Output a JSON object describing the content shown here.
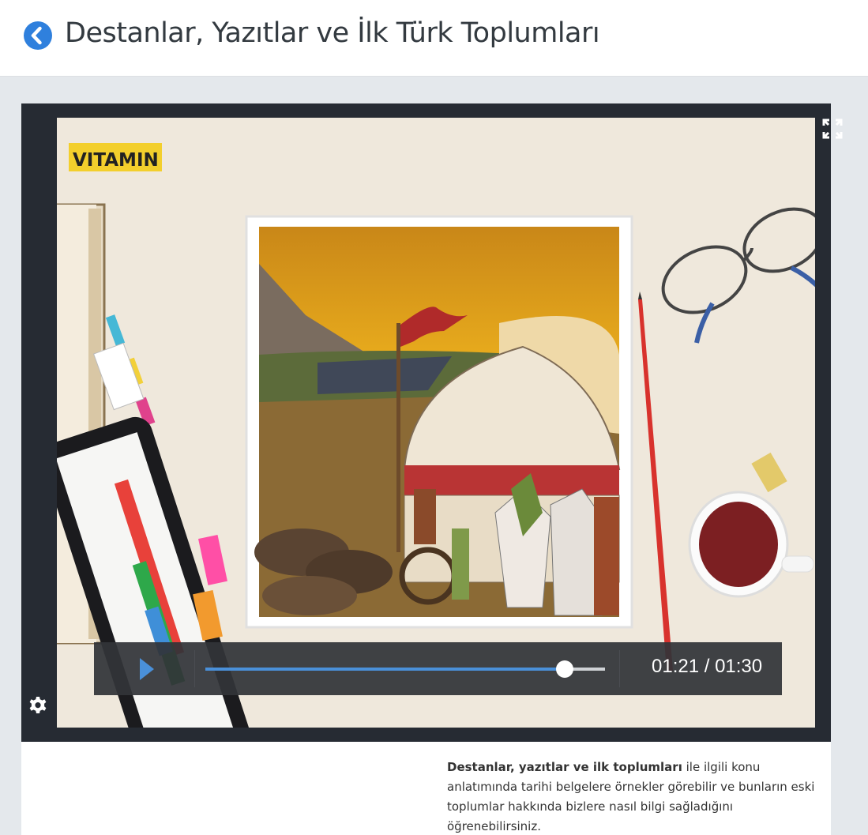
{
  "header": {
    "back_icon": "chevron-left-icon",
    "title": "Destanlar, Yazıtlar ve İlk Türk Toplumları"
  },
  "video": {
    "logo_text": "VITAMIN",
    "current_time": "01:21",
    "duration": "01:30",
    "time_display": "01:21 / 01:30",
    "progress_fraction": 0.9,
    "play_icon": "play-icon",
    "fullscreen_icon": "fullscreen-icon",
    "settings_icon": "gear-icon"
  },
  "description": {
    "bold": "Destanlar, yazıtlar ve ilk toplumları",
    "rest": " ile ilgili konu anlatımında tarihi belgelere örnekler görebilir ve bunların eski toplumlar hakkında bizlere nasıl bilgi sağladığını öğrenebilirsiniz."
  },
  "colors": {
    "accent": "#2f80dd",
    "player_bg": "#262b33",
    "seek_fill": "#4a90d9"
  }
}
